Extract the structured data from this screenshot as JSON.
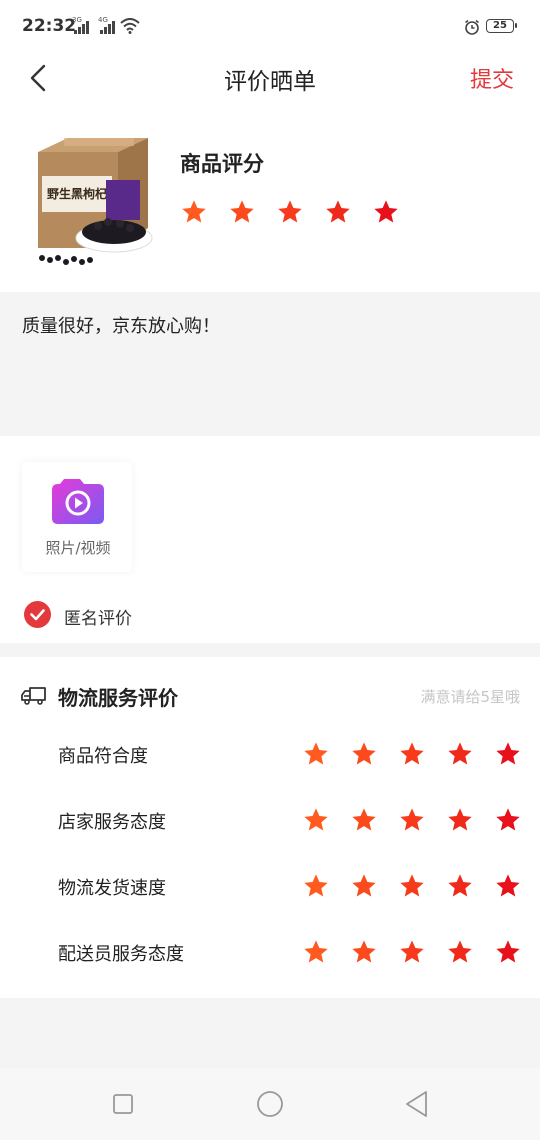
{
  "status_bar": {
    "time": "22:32",
    "net1": "3G",
    "net2": "4G",
    "battery": "25"
  },
  "nav": {
    "title": "评价晒单",
    "submit": "提交"
  },
  "product": {
    "rating_title": "商品评分",
    "stars": 5,
    "image_label": "野生黑枸杞"
  },
  "review": {
    "text": "质量很好，京东放心购！"
  },
  "upload": {
    "label": "照片/视频"
  },
  "anonymous": {
    "label": "匿名评价",
    "checked": true
  },
  "service": {
    "title": "物流服务评价",
    "hint": "满意请给5星哦",
    "rows": [
      {
        "label": "商品符合度",
        "stars": 5
      },
      {
        "label": "店家服务态度",
        "stars": 5
      },
      {
        "label": "物流发货速度",
        "stars": 5
      },
      {
        "label": "配送员服务态度",
        "stars": 5
      }
    ]
  },
  "colors": {
    "accent": "#e4393c",
    "star_start": "#ff5a1f",
    "star_end": "#e8101a"
  }
}
